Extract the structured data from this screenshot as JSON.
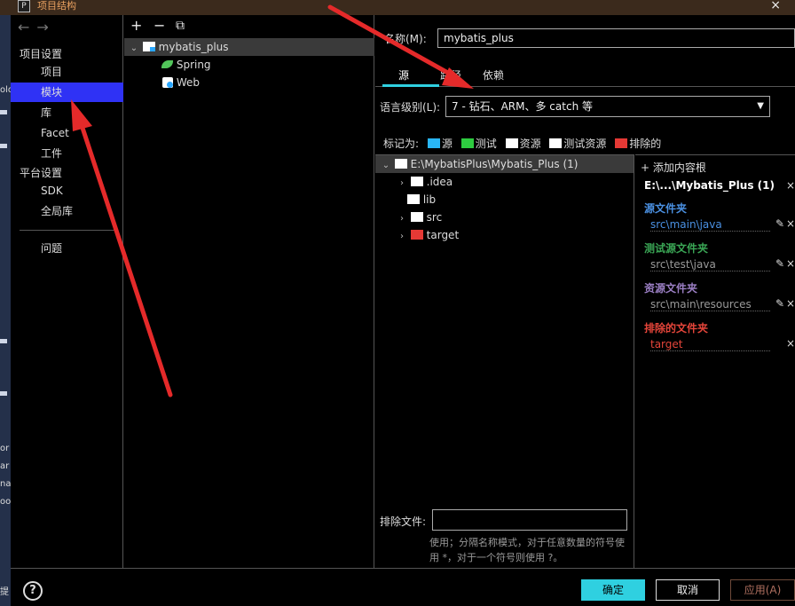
{
  "window": {
    "title": "项目结构",
    "app_icon": "P",
    "close": "×"
  },
  "edge_fragments": [
    "in",
    "olo",
    "or",
    "ar",
    "na",
    "oo",
    "提"
  ],
  "nav": {
    "back": "←",
    "forward": "→",
    "project_settings": "项目设置",
    "items_project": [
      "项目",
      "模块",
      "库",
      "Facet",
      "工件"
    ],
    "platform_settings": "平台设置",
    "items_platform": [
      "SDK",
      "全局库"
    ],
    "problems": "问题",
    "selected": "模块"
  },
  "module_tree": {
    "toolbar": {
      "add": "+",
      "remove": "−",
      "copy": "⧉"
    },
    "module": "mybatis_plus",
    "facets": [
      "Spring",
      "Web"
    ]
  },
  "details": {
    "name_label": "名称(M):",
    "name_value": "mybatis_plus",
    "tabs": [
      "源",
      "路径",
      "依赖"
    ],
    "active_tab": "源",
    "lang_label": "语言级别(L):",
    "lang_value": "7 - 钻石、ARM、多 catch 等",
    "mark_as_label": "标记为:",
    "mark_as": [
      {
        "label": "源",
        "color": "#29b6f6"
      },
      {
        "label": "测试",
        "color": "#2ecc40"
      },
      {
        "label": "资源",
        "color": "#ffffff"
      },
      {
        "label": "测试资源",
        "color": "#ffffff"
      },
      {
        "label": "排除的",
        "color": "#e53935"
      }
    ],
    "root_tree": {
      "root": "E:\\MybatisPlus\\Mybatis_Plus (1)",
      "children": [
        {
          "name": ".idea",
          "expandable": true,
          "color": "#ffffff"
        },
        {
          "name": "lib",
          "expandable": false,
          "color": "#ffffff"
        },
        {
          "name": "src",
          "expandable": true,
          "color": "#ffffff"
        },
        {
          "name": "target",
          "expandable": true,
          "color": "#e53935"
        }
      ]
    },
    "content_roots": {
      "add_label": "添加内容根",
      "root_short": "E:\\...\\Mybatis_Plus (1)",
      "groups": [
        {
          "title": "源文件夹",
          "path": "src\\main\\java",
          "color": "#4a90e2",
          "editable": true
        },
        {
          "title": "测试源文件夹",
          "path": "src\\test\\java",
          "color": "#3aa655",
          "editable": true
        },
        {
          "title": "资源文件夹",
          "path": "src\\main\\resources",
          "color": "#9b7fc4",
          "editable": true
        },
        {
          "title": "排除的文件夹",
          "path": "target",
          "color": "#e5453a",
          "editable": false
        }
      ]
    },
    "exclude_label": "排除文件:",
    "exclude_value": "",
    "exclude_hint": "使用；分隔名称模式，对于任意数量的符号使用 *，对于一个符号则使用 ?。"
  },
  "buttons": {
    "help": "?",
    "ok": "确定",
    "cancel": "取消",
    "apply": "应用(A)"
  }
}
